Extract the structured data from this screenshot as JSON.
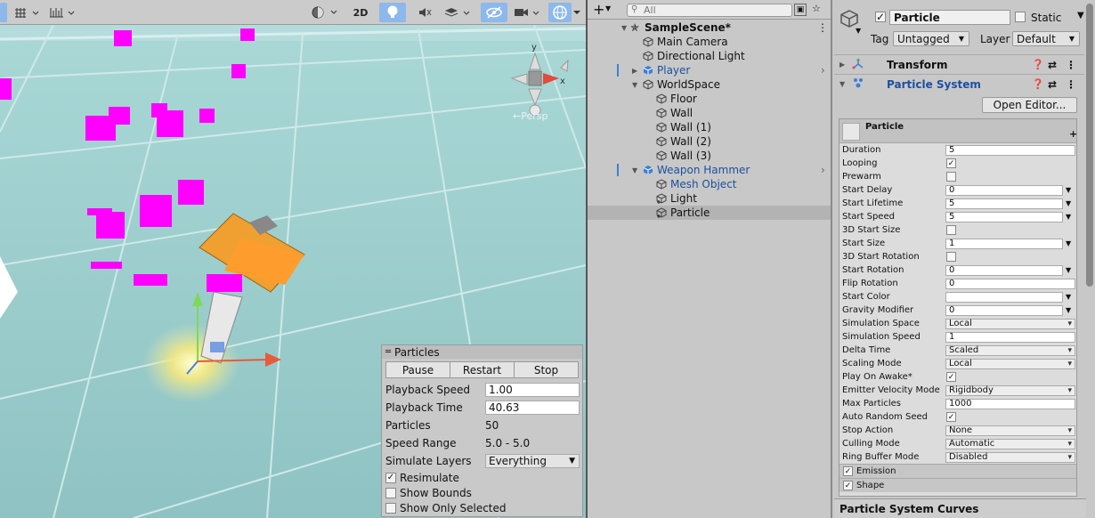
{
  "scene_toolbar": {
    "mode_2d": "2D"
  },
  "scene": {
    "persp_label": "←Persp"
  },
  "particles_overlay": {
    "title": "Particles",
    "pause": "Pause",
    "restart": "Restart",
    "stop": "Stop",
    "playback_speed_label": "Playback Speed",
    "playback_speed": "1.00",
    "playback_time_label": "Playback Time",
    "playback_time": "40.63",
    "particles_label": "Particles",
    "particles": "50",
    "speed_range_label": "Speed Range",
    "speed_range": "5.0 - 5.0",
    "simulate_layers_label": "Simulate Layers",
    "simulate_layers": "Everything",
    "resimulate": "Resimulate",
    "show_bounds": "Show Bounds",
    "show_only_selected": "Show Only Selected"
  },
  "hierarchy": {
    "search_placeholder": "All",
    "items": [
      {
        "label": "SampleScene*"
      },
      {
        "label": "Main Camera"
      },
      {
        "label": "Directional Light"
      },
      {
        "label": "Player"
      },
      {
        "label": "WorldSpace"
      },
      {
        "label": "Floor"
      },
      {
        "label": "Wall"
      },
      {
        "label": "Wall (1)"
      },
      {
        "label": "Wall (2)"
      },
      {
        "label": "Wall (3)"
      },
      {
        "label": "Weapon Hammer"
      },
      {
        "label": "Mesh Object"
      },
      {
        "label": "Light"
      },
      {
        "label": "Particle"
      }
    ]
  },
  "inspector": {
    "object_name": "Particle",
    "static_label": "Static",
    "tag_label": "Tag",
    "tag_value": "Untagged",
    "layer_label": "Layer",
    "layer_value": "Default",
    "transform_label": "Transform",
    "particle_system_label": "Particle System",
    "open_editor": "Open Editor...",
    "module_title": "Particle",
    "props": [
      {
        "label": "Duration",
        "value": "5"
      },
      {
        "label": "Looping",
        "value": "✓"
      },
      {
        "label": "Prewarm",
        "value": ""
      },
      {
        "label": "Start Delay",
        "value": "0"
      },
      {
        "label": "Start Lifetime",
        "value": "5"
      },
      {
        "label": "Start Speed",
        "value": "5"
      },
      {
        "label": "3D Start Size",
        "value": ""
      },
      {
        "label": "Start Size",
        "value": "1"
      },
      {
        "label": "3D Start Rotation",
        "value": ""
      },
      {
        "label": "Start Rotation",
        "value": "0"
      },
      {
        "label": "Flip Rotation",
        "value": "0"
      },
      {
        "label": "Start Color",
        "value": ""
      },
      {
        "label": "Gravity Modifier",
        "value": "0"
      },
      {
        "label": "Simulation Space",
        "value": "Local"
      },
      {
        "label": "Simulation Speed",
        "value": "1"
      },
      {
        "label": "Delta Time",
        "value": "Scaled"
      },
      {
        "label": "Scaling Mode",
        "value": "Local"
      },
      {
        "label": "Play On Awake*",
        "value": "✓"
      },
      {
        "label": "Emitter Velocity Mode",
        "value": "Rigidbody"
      },
      {
        "label": "Max Particles",
        "value": "1000"
      },
      {
        "label": "Auto Random Seed",
        "value": "✓"
      },
      {
        "label": "Stop Action",
        "value": "None"
      },
      {
        "label": "Culling Mode",
        "value": "Automatic"
      },
      {
        "label": "Ring Buffer Mode",
        "value": "Disabled"
      }
    ],
    "emission": "Emission",
    "shape": "Shape",
    "curves_label": "Particle System Curves"
  }
}
